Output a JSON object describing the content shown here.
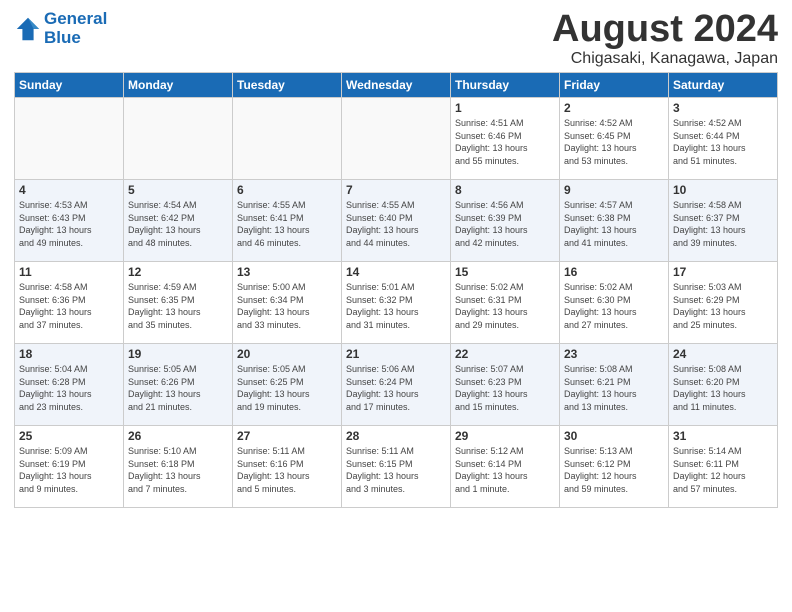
{
  "header": {
    "logo_line1": "General",
    "logo_line2": "Blue",
    "month_year": "August 2024",
    "location": "Chigasaki, Kanagawa, Japan"
  },
  "days_of_week": [
    "Sunday",
    "Monday",
    "Tuesday",
    "Wednesday",
    "Thursday",
    "Friday",
    "Saturday"
  ],
  "weeks": [
    [
      {
        "day": "",
        "info": ""
      },
      {
        "day": "",
        "info": ""
      },
      {
        "day": "",
        "info": ""
      },
      {
        "day": "",
        "info": ""
      },
      {
        "day": "1",
        "info": "Sunrise: 4:51 AM\nSunset: 6:46 PM\nDaylight: 13 hours\nand 55 minutes."
      },
      {
        "day": "2",
        "info": "Sunrise: 4:52 AM\nSunset: 6:45 PM\nDaylight: 13 hours\nand 53 minutes."
      },
      {
        "day": "3",
        "info": "Sunrise: 4:52 AM\nSunset: 6:44 PM\nDaylight: 13 hours\nand 51 minutes."
      }
    ],
    [
      {
        "day": "4",
        "info": "Sunrise: 4:53 AM\nSunset: 6:43 PM\nDaylight: 13 hours\nand 49 minutes."
      },
      {
        "day": "5",
        "info": "Sunrise: 4:54 AM\nSunset: 6:42 PM\nDaylight: 13 hours\nand 48 minutes."
      },
      {
        "day": "6",
        "info": "Sunrise: 4:55 AM\nSunset: 6:41 PM\nDaylight: 13 hours\nand 46 minutes."
      },
      {
        "day": "7",
        "info": "Sunrise: 4:55 AM\nSunset: 6:40 PM\nDaylight: 13 hours\nand 44 minutes."
      },
      {
        "day": "8",
        "info": "Sunrise: 4:56 AM\nSunset: 6:39 PM\nDaylight: 13 hours\nand 42 minutes."
      },
      {
        "day": "9",
        "info": "Sunrise: 4:57 AM\nSunset: 6:38 PM\nDaylight: 13 hours\nand 41 minutes."
      },
      {
        "day": "10",
        "info": "Sunrise: 4:58 AM\nSunset: 6:37 PM\nDaylight: 13 hours\nand 39 minutes."
      }
    ],
    [
      {
        "day": "11",
        "info": "Sunrise: 4:58 AM\nSunset: 6:36 PM\nDaylight: 13 hours\nand 37 minutes."
      },
      {
        "day": "12",
        "info": "Sunrise: 4:59 AM\nSunset: 6:35 PM\nDaylight: 13 hours\nand 35 minutes."
      },
      {
        "day": "13",
        "info": "Sunrise: 5:00 AM\nSunset: 6:34 PM\nDaylight: 13 hours\nand 33 minutes."
      },
      {
        "day": "14",
        "info": "Sunrise: 5:01 AM\nSunset: 6:32 PM\nDaylight: 13 hours\nand 31 minutes."
      },
      {
        "day": "15",
        "info": "Sunrise: 5:02 AM\nSunset: 6:31 PM\nDaylight: 13 hours\nand 29 minutes."
      },
      {
        "day": "16",
        "info": "Sunrise: 5:02 AM\nSunset: 6:30 PM\nDaylight: 13 hours\nand 27 minutes."
      },
      {
        "day": "17",
        "info": "Sunrise: 5:03 AM\nSunset: 6:29 PM\nDaylight: 13 hours\nand 25 minutes."
      }
    ],
    [
      {
        "day": "18",
        "info": "Sunrise: 5:04 AM\nSunset: 6:28 PM\nDaylight: 13 hours\nand 23 minutes."
      },
      {
        "day": "19",
        "info": "Sunrise: 5:05 AM\nSunset: 6:26 PM\nDaylight: 13 hours\nand 21 minutes."
      },
      {
        "day": "20",
        "info": "Sunrise: 5:05 AM\nSunset: 6:25 PM\nDaylight: 13 hours\nand 19 minutes."
      },
      {
        "day": "21",
        "info": "Sunrise: 5:06 AM\nSunset: 6:24 PM\nDaylight: 13 hours\nand 17 minutes."
      },
      {
        "day": "22",
        "info": "Sunrise: 5:07 AM\nSunset: 6:23 PM\nDaylight: 13 hours\nand 15 minutes."
      },
      {
        "day": "23",
        "info": "Sunrise: 5:08 AM\nSunset: 6:21 PM\nDaylight: 13 hours\nand 13 minutes."
      },
      {
        "day": "24",
        "info": "Sunrise: 5:08 AM\nSunset: 6:20 PM\nDaylight: 13 hours\nand 11 minutes."
      }
    ],
    [
      {
        "day": "25",
        "info": "Sunrise: 5:09 AM\nSunset: 6:19 PM\nDaylight: 13 hours\nand 9 minutes."
      },
      {
        "day": "26",
        "info": "Sunrise: 5:10 AM\nSunset: 6:18 PM\nDaylight: 13 hours\nand 7 minutes."
      },
      {
        "day": "27",
        "info": "Sunrise: 5:11 AM\nSunset: 6:16 PM\nDaylight: 13 hours\nand 5 minutes."
      },
      {
        "day": "28",
        "info": "Sunrise: 5:11 AM\nSunset: 6:15 PM\nDaylight: 13 hours\nand 3 minutes."
      },
      {
        "day": "29",
        "info": "Sunrise: 5:12 AM\nSunset: 6:14 PM\nDaylight: 13 hours\nand 1 minute."
      },
      {
        "day": "30",
        "info": "Sunrise: 5:13 AM\nSunset: 6:12 PM\nDaylight: 12 hours\nand 59 minutes."
      },
      {
        "day": "31",
        "info": "Sunrise: 5:14 AM\nSunset: 6:11 PM\nDaylight: 12 hours\nand 57 minutes."
      }
    ]
  ]
}
